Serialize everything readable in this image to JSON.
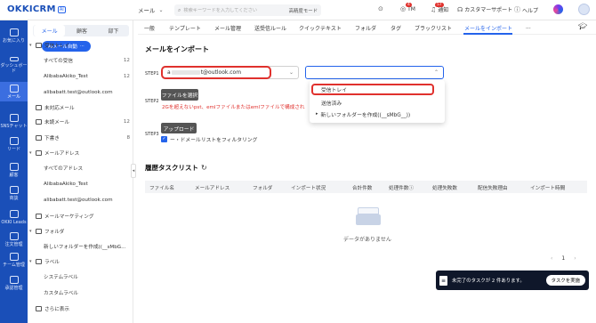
{
  "brand": {
    "logo": "OKKICRM",
    "badge": "AI"
  },
  "topbar": {
    "mail_menu": "メール",
    "search_placeholder": "検索キーワードを入力してください",
    "search_mode": "高精度モード",
    "tm_label": "TM",
    "tm_badge": "4",
    "notify_label": "通知",
    "notify_badge": "57",
    "support_label": "カスタマーサポート",
    "help_label": "ヘルプ"
  },
  "rail": [
    {
      "label": "お気に入り",
      "icon": "star-icon"
    },
    {
      "label": "ダッシュボード",
      "icon": "dashboard-icon"
    },
    {
      "label": "メール",
      "icon": "mail-icon",
      "active": true
    },
    {
      "label": "SNSチャット",
      "icon": "chat-icon"
    },
    {
      "label": "リード",
      "icon": "lead-icon"
    },
    {
      "label": "顧客",
      "icon": "customer-icon"
    },
    {
      "label": "商談",
      "icon": "deal-icon"
    },
    {
      "label": "OKKI Leads",
      "icon": "leads-icon"
    },
    {
      "label": "注文管理",
      "icon": "order-icon"
    },
    {
      "label": "チーム管理",
      "icon": "team-icon"
    },
    {
      "label": "承認管理",
      "icon": "approval-icon"
    }
  ],
  "sidebar": {
    "tabs": [
      "メール",
      "顧客",
      "部下"
    ],
    "ai_button": "AIメール自動",
    "items": [
      {
        "label": "受信トレイ",
        "type": "section"
      },
      {
        "label": "すべての受信",
        "count": "12",
        "type": "sub"
      },
      {
        "label": "AlibabaAkiko_Test",
        "count": "12",
        "type": "sub"
      },
      {
        "label": "alibabatt.test@outlook.com",
        "type": "sub"
      },
      {
        "label": "未対応メール",
        "type": "item"
      },
      {
        "label": "未読メール",
        "count": "12",
        "type": "item"
      },
      {
        "label": "下書き",
        "count": "8",
        "type": "item"
      },
      {
        "label": "メールアドレス",
        "type": "section"
      },
      {
        "label": "すべてのアドレス",
        "type": "sub"
      },
      {
        "label": "AlibabaAkiko_Test",
        "type": "sub"
      },
      {
        "label": "alibabatt.test@outlook.com",
        "type": "sub"
      },
      {
        "label": "メールマーケティング",
        "type": "item"
      },
      {
        "label": "フォルダ",
        "type": "section"
      },
      {
        "label": "新しいフォルダーを作成((__sMbG...",
        "type": "sub"
      },
      {
        "label": "ラベル",
        "type": "section"
      },
      {
        "label": "システムラベル",
        "type": "sub"
      },
      {
        "label": "カスタムラベル",
        "type": "sub"
      },
      {
        "label": "さらに表示",
        "type": "item"
      }
    ]
  },
  "tabs": [
    "一般",
    "テンプレート",
    "メール管理",
    "送受信ルール",
    "クイックテキスト",
    "フォルダ",
    "タグ",
    "ブラックリスト",
    "メールをインポート",
    "..."
  ],
  "import": {
    "heading": "メールをインポート",
    "step1_label": "STEP1",
    "account_value": "a",
    "account_suffix": "t@outlook.com",
    "step2_label": "STEP2",
    "file_button": "ファイルを選択",
    "file_hint": "2Gを超えないpst、emlファイルまたはemlファイルで構成され",
    "step3_label": "STEP3",
    "upload_button": "アップロード",
    "filter_label": "ー・ドメールリストをフィルタリング",
    "dropdown": [
      "受信トレイ",
      "送信済み",
      "新しいフォルダーを作成((__sMbG__))"
    ]
  },
  "history": {
    "title": "履歴タスクリスト",
    "columns": [
      "ファイル名",
      "メールアドレス",
      "フォルダ",
      "インポート状況",
      "合計件数",
      "処理件数ⓘ",
      "処理失敗数",
      "配信失敗理由",
      "インポート時間"
    ],
    "empty_text": "データがありません",
    "page": "1"
  },
  "toast": {
    "text": "未完了のタスクが 2 件あります。",
    "button": "タスクを実施"
  },
  "colors": {
    "primary": "#2463eb",
    "rail": "#1a4fb8",
    "danger": "#e0312d",
    "dark": "#111827"
  }
}
